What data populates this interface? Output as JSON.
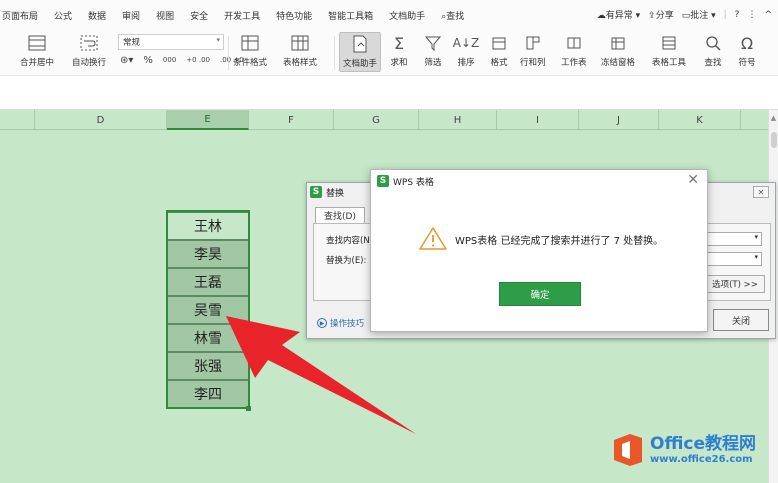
{
  "menubar": {
    "items": [
      "页面布局",
      "公式",
      "数据",
      "审阅",
      "视图",
      "安全",
      "开发工具",
      "特色功能",
      "智能工具箱",
      "文档助手"
    ],
    "search": "查找",
    "right": {
      "status": "有异常",
      "share": "分享",
      "comment": "批注",
      "help": "?",
      "more": "⋮",
      "collapse": "^"
    }
  },
  "toolbar": {
    "merge_center": "合并居中",
    "wrap_text": "自动换行",
    "number_format": "常规",
    "percent": "%",
    "thousands": "000",
    "inc_decimal": "+0 .00",
    "dec_decimal": ".00 +0",
    "conditional_format": "条件格式",
    "table_style": "表格样式",
    "doc_assistant": "文档助手",
    "sum": "求和",
    "filter": "筛选",
    "sort": "排序",
    "format": "格式",
    "row_col": "行和列",
    "worksheet": "工作表",
    "freeze": "冻结窗格",
    "table_tools": "表格工具",
    "find": "查找",
    "symbol": "符号"
  },
  "sheet": {
    "columns": [
      "D",
      "E",
      "F",
      "G",
      "H",
      "I",
      "J",
      "K"
    ],
    "selected_column": "E",
    "cells": [
      "王林",
      "李昊",
      "王磊",
      "吴雪",
      "林雪",
      "张强",
      "李四"
    ]
  },
  "replace_dialog": {
    "title": "替换",
    "tab_find": "查找(D)",
    "find_label": "查找内容(N):",
    "replace_label": "替换为(E):",
    "options": "选项(T) >>",
    "tips": "操作技巧",
    "close": "关闭"
  },
  "message_dialog": {
    "title": "WPS 表格",
    "message": "WPS表格 已经完成了搜索并进行了 7 处替换。",
    "ok": "确定"
  },
  "watermark": {
    "title": "Office教程网",
    "url": "www.office26.com"
  },
  "colors": {
    "sheet_bg": "#c6e7c8",
    "selection": "#2e8b3a",
    "wps_green": "#2e9d47",
    "arrow_red": "#e8232a"
  }
}
